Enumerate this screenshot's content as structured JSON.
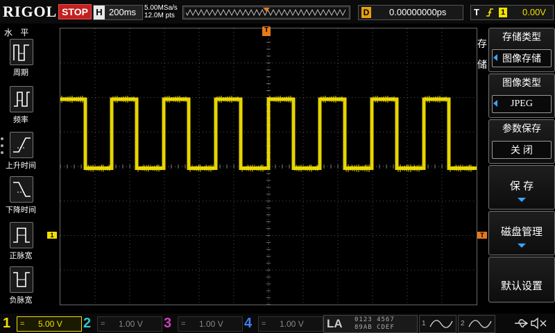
{
  "colors": {
    "ch1": "#f2e000",
    "ch2": "#2fc9c9",
    "ch3": "#d040c0",
    "ch4": "#3d7ff2",
    "trigger_orange": "#e87a1c",
    "menu_blue": "#3aa5ff"
  },
  "header": {
    "logo": "RIGOL",
    "run_state": "STOP",
    "timebase_key": "H",
    "timebase": "200ms",
    "sample_rate": "5.00MSa/s",
    "memory_depth": "12.0M pts",
    "delay_key": "D",
    "delay": "0.00000000ps",
    "trigger_key": "T",
    "trigger_source": "1",
    "trigger_level": "0.00V"
  },
  "left_panel": {
    "title": "水 平",
    "items": [
      {
        "label": "周期",
        "icon": "period-icon"
      },
      {
        "label": "频率",
        "icon": "frequency-icon"
      },
      {
        "label": "上升时间",
        "icon": "rise-time-icon"
      },
      {
        "label": "下降时间",
        "icon": "fall-time-icon"
      },
      {
        "label": "正脉宽",
        "icon": "positive-width-icon"
      },
      {
        "label": "负脉宽",
        "icon": "negative-width-icon"
      }
    ]
  },
  "right_menu": {
    "side_label_1": "存",
    "side_label_2": "储",
    "storage_type": {
      "title": "存储类型",
      "value": "图像存储"
    },
    "image_type": {
      "title": "图像类型",
      "value": "JPEG"
    },
    "param_save": {
      "title": "参数保存",
      "value": "关 闭"
    },
    "save": "保 存",
    "disk_manage": "磁盘管理",
    "default_settings": "默认设置"
  },
  "markers": {
    "ch1_marker": "1",
    "trigger_marker": "T"
  },
  "channels": [
    {
      "num": "1",
      "coupling": "=",
      "scale": "5.00 V"
    },
    {
      "num": "2",
      "coupling": "=",
      "scale": "1.00 V"
    },
    {
      "num": "3",
      "coupling": "=",
      "scale": "1.00 V"
    },
    {
      "num": "4",
      "coupling": "=",
      "scale": "1.00 V"
    }
  ],
  "bottom": {
    "la": "LA",
    "la_top": "0123 4567",
    "la_bottom": "89AB CDEF",
    "gen1": "1",
    "gen2": "2"
  },
  "signal": {
    "type": "square",
    "high_div": 1.95,
    "low_div": -0.05,
    "transitions": [
      {
        "t": 0.0,
        "level": "high"
      },
      {
        "t": 0.72,
        "level": "low"
      },
      {
        "t": 1.48,
        "level": "high"
      },
      {
        "t": 2.2,
        "level": "low"
      },
      {
        "t": 2.98,
        "level": "high"
      },
      {
        "t": 3.7,
        "level": "low"
      },
      {
        "t": 4.48,
        "level": "high"
      },
      {
        "t": 5.2,
        "level": "low"
      },
      {
        "t": 6.0,
        "level": "high"
      },
      {
        "t": 6.72,
        "level": "low"
      },
      {
        "t": 7.48,
        "level": "high"
      },
      {
        "t": 8.2,
        "level": "low"
      },
      {
        "t": 8.98,
        "level": "high"
      },
      {
        "t": 9.7,
        "level": "low"
      },
      {
        "t": 10.48,
        "level": "high"
      },
      {
        "t": 11.2,
        "level": "low"
      },
      {
        "t": 12.0,
        "level": "end"
      }
    ]
  }
}
